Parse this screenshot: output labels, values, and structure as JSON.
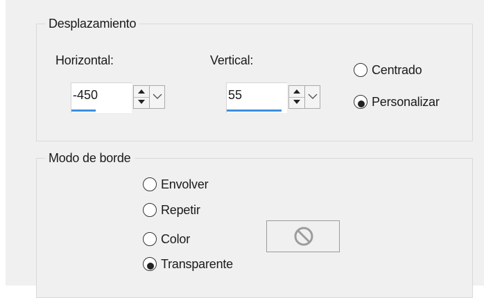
{
  "offset_group": {
    "title": "Desplazamiento",
    "horizontal": {
      "label": "Horizontal:",
      "value": "-450",
      "slider_fraction": 0.4
    },
    "vertical": {
      "label": "Vertical:",
      "value": "55",
      "slider_fraction": 0.9
    },
    "centering": {
      "options": [
        {
          "label": "Centrado",
          "selected": false
        },
        {
          "label": "Personalizar",
          "selected": true
        }
      ]
    }
  },
  "edge_group": {
    "title": "Modo de borde",
    "options": [
      {
        "label": "Envolver",
        "selected": false
      },
      {
        "label": "Repetir",
        "selected": false
      },
      {
        "label": "Color",
        "selected": false
      },
      {
        "label": "Transparente",
        "selected": true
      }
    ],
    "color_swatch_icon": "no-symbol-icon"
  },
  "colors": {
    "panel_bg": "#f0f0f0",
    "slider_fill": "#3c8fe0",
    "border": "#d9d9d9"
  }
}
